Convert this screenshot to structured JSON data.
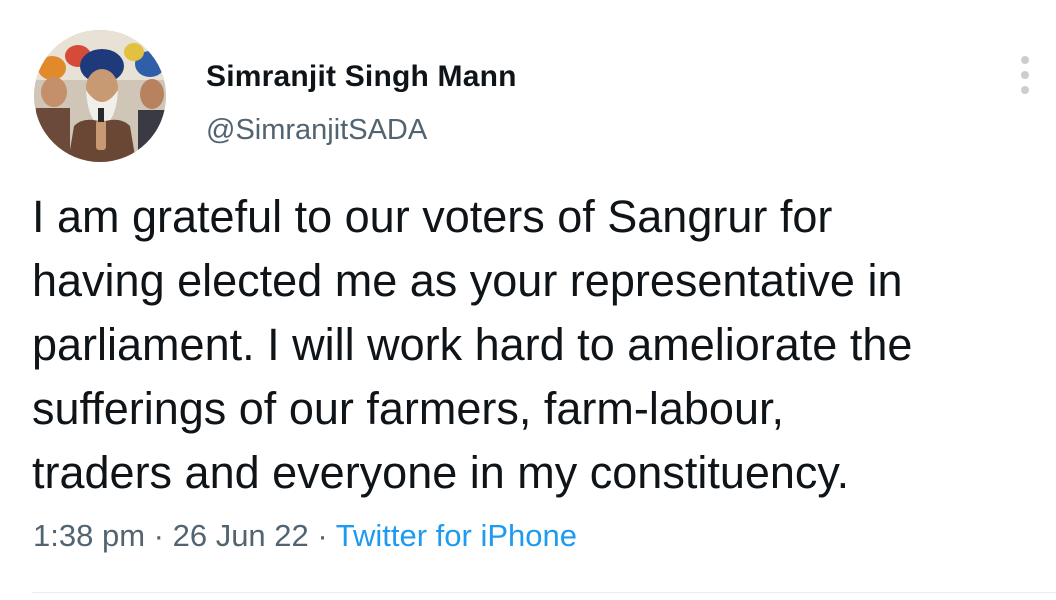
{
  "tweet": {
    "author": {
      "name": "Simranjit Singh Mann",
      "handle": "@SimranjitSADA",
      "avatar_icon": "profile-photo"
    },
    "more_icon": "vertical-ellipsis-icon",
    "text_lines": [
      "I am grateful to our voters of Sangrur for",
      "having elected me as your representative in",
      "parliament. I will work hard to ameliorate the",
      "sufferings of our farmers, farm-labour,",
      "traders and everyone in my constituency."
    ],
    "time": "1:38 pm",
    "date": "26 Jun 22",
    "separator": "·",
    "source": "Twitter for iPhone"
  },
  "colors": {
    "text": "#0f1419",
    "secondary": "#536471",
    "link": "#1d9bf0",
    "divider": "#e6ecf0"
  }
}
